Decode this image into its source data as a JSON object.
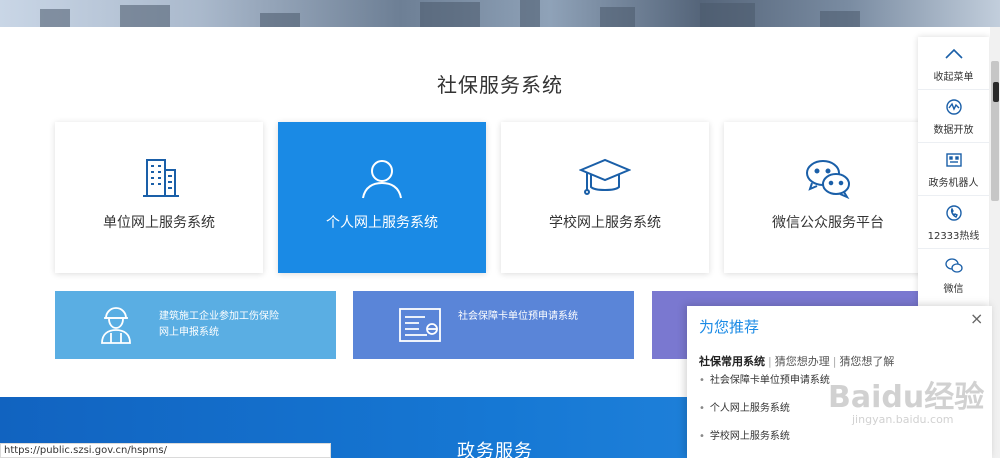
{
  "section": {
    "title": "社保服务系统"
  },
  "cards": [
    {
      "label": "单位网上服务系统"
    },
    {
      "label": "个人网上服务系统"
    },
    {
      "label": "学校网上服务系统"
    },
    {
      "label": "微信公众服务平台"
    }
  ],
  "tiles": [
    {
      "line1": "建筑施工企业参加工伤保险",
      "line2": "网上申报系统"
    },
    {
      "line1": "社会保障卡单位预申请系统"
    }
  ],
  "float_menu": [
    {
      "label": "收起菜单",
      "icon": "chevron-up-icon"
    },
    {
      "label": "数据开放",
      "icon": "data-icon"
    },
    {
      "label": "政务机器人",
      "icon": "robot-icon"
    },
    {
      "label": "12333热线",
      "icon": "phone-icon"
    },
    {
      "label": "微信",
      "icon": "wechat-icon"
    }
  ],
  "recommend": {
    "title": "为您推荐",
    "close": "×",
    "tabs": [
      "社保常用系统",
      "猜您想办理",
      "猜您想了解"
    ],
    "items": [
      "社会保障卡单位预申请系统",
      "个人网上服务系统",
      "学校网上服务系统"
    ]
  },
  "bottom_band": {
    "title": "政务服务"
  },
  "status_bar": {
    "url": "https://public.szsi.gov.cn/hspms/"
  },
  "watermark": {
    "brand": "Baidu经验",
    "url": "jingyan.baidu.com"
  },
  "colors": {
    "primary": "#1a8ae5",
    "tile1": "#5aaee3",
    "tile2": "#5a85d8",
    "tile3": "#7a78d0"
  }
}
